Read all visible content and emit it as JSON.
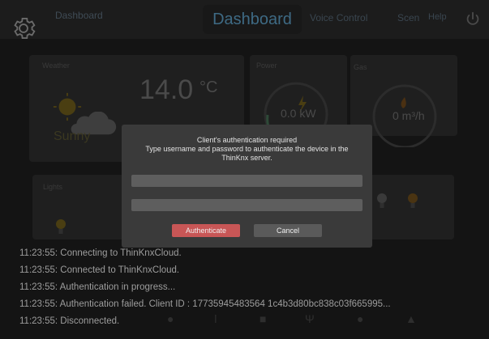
{
  "nav": {
    "dashboard_small": "Dashboard",
    "dashboard": "Dashboard",
    "voice_control": "Voice Control",
    "scenes": "Scen",
    "help": "Help"
  },
  "weather": {
    "label": "Weather",
    "condition": "Sunny",
    "temperature": "14.0",
    "unit": "°C"
  },
  "power": {
    "label": "Power",
    "value": "0.0 kW"
  },
  "gas": {
    "label": "Gas",
    "value": "0 m³/h"
  },
  "lights": {
    "label": "Lights"
  },
  "modal": {
    "title": "Client's authentication required",
    "body": "Type username and password to authenticate the device in the ThinKnx server.",
    "username": "",
    "password": "",
    "authenticate_label": "Authenticate",
    "cancel_label": "Cancel"
  },
  "log": [
    "11:23:55: Connecting to ThinKnxCloud.",
    "11:23:55: Connected to ThinKnxCloud.",
    "11:23:55: Authentication in progress...",
    "11:23:55: Authentication failed. Client ID : 17735945483564 1c4b3d80bc838c03f665995...",
    "11:23:55: Disconnected."
  ],
  "colors": {
    "accent": "#c85656",
    "background": "#141414",
    "dialog": "#3a3a3a"
  }
}
